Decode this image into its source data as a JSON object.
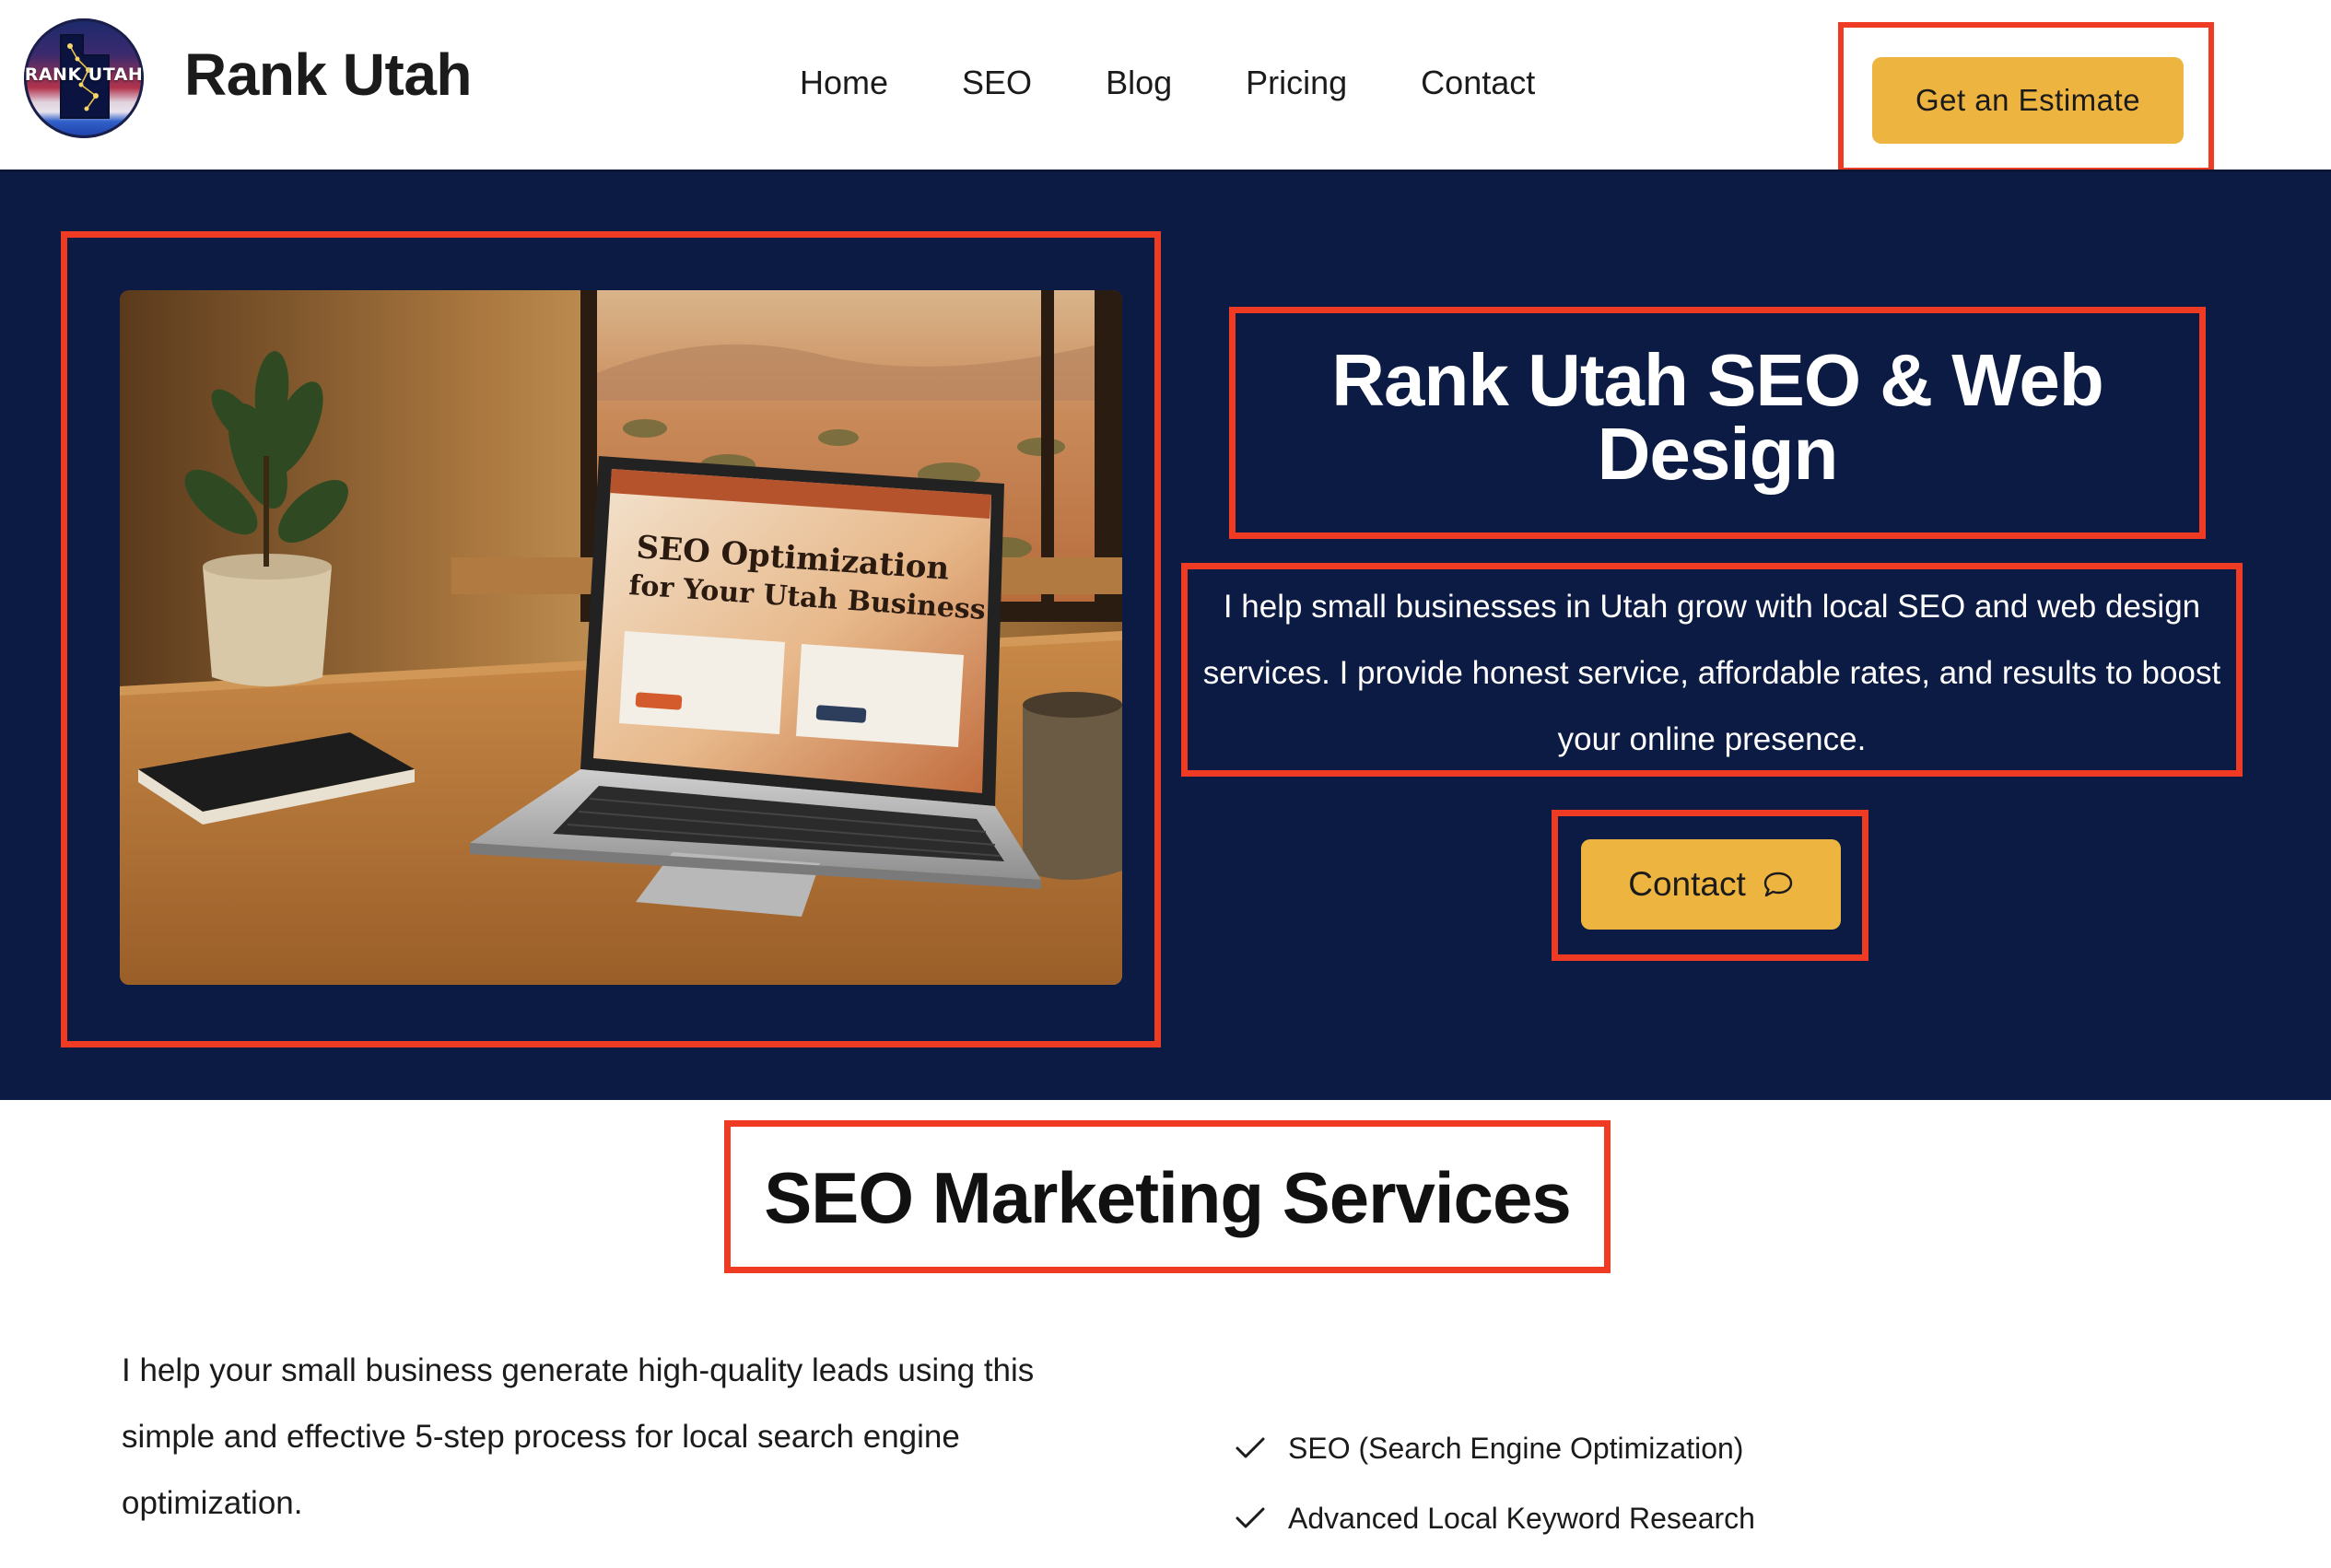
{
  "header": {
    "logo_text": "RANK UTAH",
    "brand": "Rank Utah",
    "nav": [
      "Home",
      "SEO",
      "Blog",
      "Pricing",
      "Contact"
    ],
    "cta_label": "Get an Estimate"
  },
  "hero": {
    "title": "Rank Utah SEO & Web Design",
    "description": "I help small businesses in Utah grow with local SEO and web design services. I provide honest service, affordable rates, and results to boost your online presence.",
    "contact_label": "Contact",
    "image_laptop_heading_line1": "SEO Optimization",
    "image_laptop_heading_line2": "for Your Utah Business"
  },
  "services": {
    "title": "SEO Marketing Services",
    "description": "I help your small business generate high-quality leads using this simple and effective 5-step process for local search engine optimization.",
    "items": [
      "SEO (Search Engine Optimization)",
      "Advanced Local Keyword Research"
    ]
  },
  "colors": {
    "hero_bg": "#0c1b43",
    "button": "#edb43f",
    "highlight_border": "#ef3b24"
  }
}
